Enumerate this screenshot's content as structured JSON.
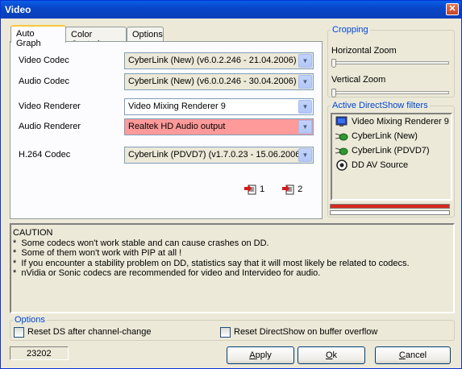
{
  "window": {
    "title": "Video",
    "close_glyph": "✕"
  },
  "tabs": [
    {
      "label": "Auto Graph",
      "active": true
    },
    {
      "label": "Color Controls",
      "active": false
    },
    {
      "label": "Options",
      "active": false
    }
  ],
  "auto_graph": {
    "video_codec": {
      "label": "Video Codec",
      "value": "CyberLink (New)   (v6.0.2.246 - 21.04.2006)"
    },
    "audio_codec": {
      "label": "Audio Codec",
      "value": "CyberLink (New)   (v6.0.0.246 - 30.04.2006)"
    },
    "video_renderer": {
      "label": "Video Renderer",
      "value": "Video Mixing Renderer 9"
    },
    "audio_renderer": {
      "label": "Audio Renderer",
      "value": "Realtek HD Audio output"
    },
    "h264_codec": {
      "label": "H.264 Codec",
      "value": "CyberLink (PDVD7)   (v1.7.0.23 - 15.06.2006)"
    },
    "route_buttons": [
      {
        "label": "1"
      },
      {
        "label": "2"
      }
    ]
  },
  "cropping": {
    "legend": "Cropping",
    "horizontal_zoom": {
      "label": "Horizontal Zoom",
      "level": 0
    },
    "vertical_zoom": {
      "label": "Vertical Zoom",
      "level": 0
    }
  },
  "directshow": {
    "legend": "Active DirectShow filters",
    "filters": [
      {
        "label": "Video Mixing Renderer 9",
        "icon": "monitor-icon"
      },
      {
        "label": "CyberLink (New)",
        "icon": "codec-arrow-icon"
      },
      {
        "label": "CyberLink (PDVD7)",
        "icon": "codec-arrow-icon"
      },
      {
        "label": "DD AV Source",
        "icon": "source-disc-icon"
      }
    ],
    "bar_colors": [
      "#d42a1e",
      "#ffffff"
    ]
  },
  "caution": {
    "lines": [
      "CAUTION",
      "",
      "*  Some codecs won't work stable and can cause crashes on DD.",
      "*  Some of them won't work with PIP at all !",
      "*  If you encounter a stability problem on DD, statistics say that it will most likely be related to codecs.",
      "*  nVidia or Sonic codecs are recommended for video and Intervideo for audio."
    ]
  },
  "options": {
    "legend": "Options",
    "reset_ds_channel": {
      "label": "Reset DS after channel-change",
      "checked": false
    },
    "reset_ds_buffer": {
      "label": "Reset DirectShow on buffer overflow",
      "checked": false
    }
  },
  "status": {
    "value": "23202"
  },
  "buttons": {
    "apply": {
      "label": "Apply",
      "mnemonic": "A",
      "rest": "pply"
    },
    "ok": {
      "label": "Ok",
      "mnemonic": "O",
      "rest": "k"
    },
    "cancel": {
      "label": "Cancel",
      "mnemonic": "C",
      "rest": "ancel"
    }
  },
  "colors": {
    "title_bar": "#0a4fd8",
    "audio_renderer_highlight": "#ff9a9a",
    "legend_text": "#0046d5"
  }
}
